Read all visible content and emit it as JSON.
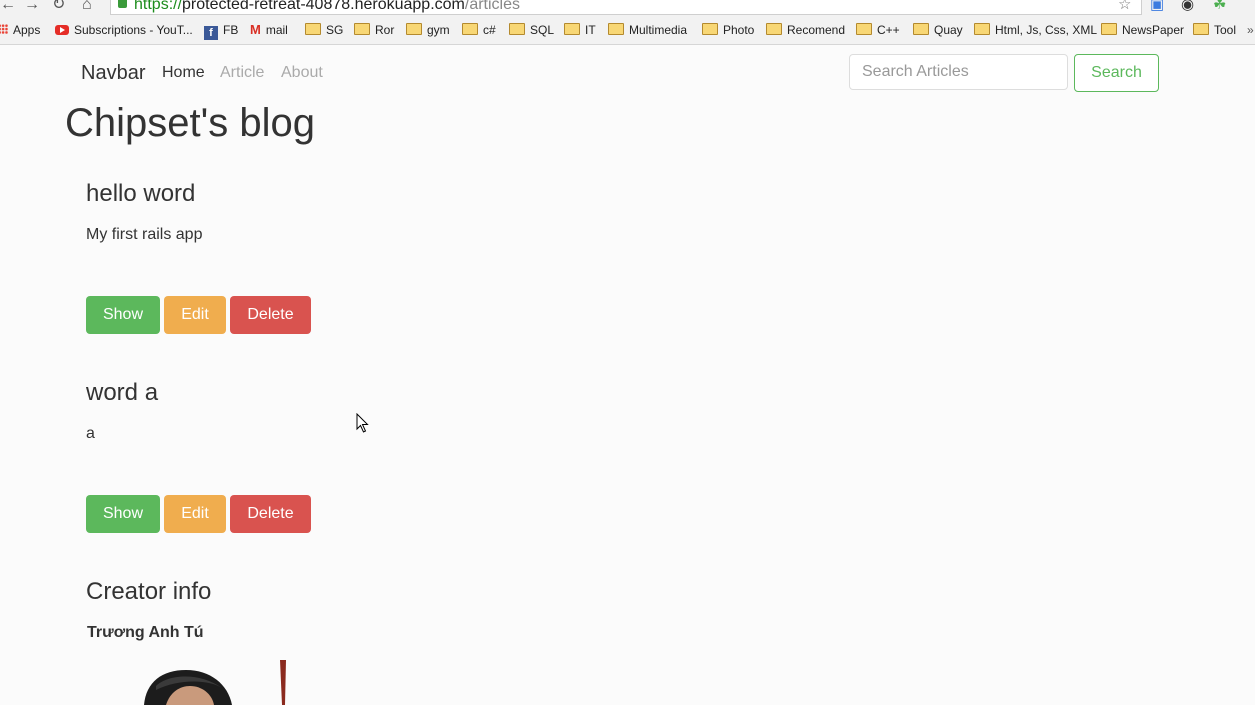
{
  "browser": {
    "url_https": "https://",
    "url_host": "protected-retreat-40878.herokuapp.com",
    "url_path": "/articles",
    "bookmarks": [
      {
        "label": "Apps",
        "icon": "apps-icon"
      },
      {
        "label": "Subscriptions - YouT...",
        "icon": "youtube-icon"
      },
      {
        "label": "FB",
        "icon": "facebook-icon"
      },
      {
        "label": "mail",
        "icon": "gmail-icon"
      },
      {
        "label": "SG",
        "icon": "folder-icon"
      },
      {
        "label": "Ror",
        "icon": "folder-icon"
      },
      {
        "label": "gym",
        "icon": "folder-icon"
      },
      {
        "label": "c#",
        "icon": "folder-icon"
      },
      {
        "label": "SQL",
        "icon": "folder-icon"
      },
      {
        "label": "IT",
        "icon": "folder-icon"
      },
      {
        "label": "Multimedia",
        "icon": "folder-icon"
      },
      {
        "label": "Photo",
        "icon": "folder-icon"
      },
      {
        "label": "Recomend",
        "icon": "folder-icon"
      },
      {
        "label": "C++",
        "icon": "folder-icon"
      },
      {
        "label": "Quay",
        "icon": "folder-icon"
      },
      {
        "label": "Html, Js, Css, XML",
        "icon": "folder-icon"
      },
      {
        "label": "NewsPaper",
        "icon": "folder-icon"
      },
      {
        "label": "Tool",
        "icon": "folder-icon"
      }
    ]
  },
  "navbar": {
    "brand": "Navbar",
    "links": [
      "Home",
      "Article",
      "About"
    ],
    "search_placeholder": "Search Articles",
    "search_button": "Search"
  },
  "page": {
    "title": "Chipset's blog"
  },
  "articles": [
    {
      "title": "hello word",
      "body": "My first rails app",
      "show": "Show",
      "edit": "Edit",
      "delete": "Delete"
    },
    {
      "title": "word a",
      "body": "a",
      "show": "Show",
      "edit": "Edit",
      "delete": "Delete"
    }
  ],
  "creator": {
    "heading": "Creator info",
    "name": "Trương Anh Tú"
  },
  "colors": {
    "success": "#5cb85c",
    "warning": "#f0ad4e",
    "danger": "#d9534f"
  }
}
